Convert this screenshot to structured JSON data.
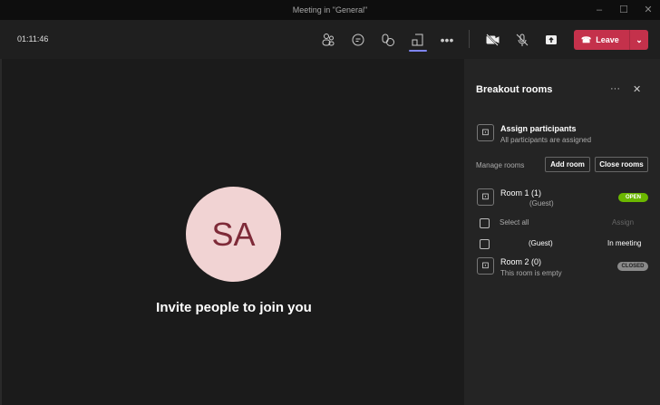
{
  "window": {
    "title": "Meeting in \"General\""
  },
  "toolbar": {
    "timer": "01:11:46",
    "leave_label": "Leave"
  },
  "stage": {
    "avatar_initials": "SA",
    "invite_text": "Invite people to join you"
  },
  "panel": {
    "title": "Breakout rooms",
    "assign": {
      "title": "Assign participants",
      "subtitle": "All participants are assigned"
    },
    "manage_label": "Manage rooms",
    "add_room": "Add room",
    "close_rooms": "Close rooms",
    "rooms": [
      {
        "name": "Room 1 (1)",
        "detail": "(Guest)",
        "status": "OPEN"
      },
      {
        "name": "Room 2 (0)",
        "detail": "This room is empty",
        "status": "CLOSED"
      }
    ],
    "select_all": "Select all",
    "assign_label": "Assign",
    "participant": {
      "name": "(Guest)",
      "state": "In meeting"
    }
  },
  "colors": {
    "accent": "#7f85f5",
    "leave": "#c4314b",
    "open": "#6bb700",
    "closed": "#8a8a8a"
  }
}
